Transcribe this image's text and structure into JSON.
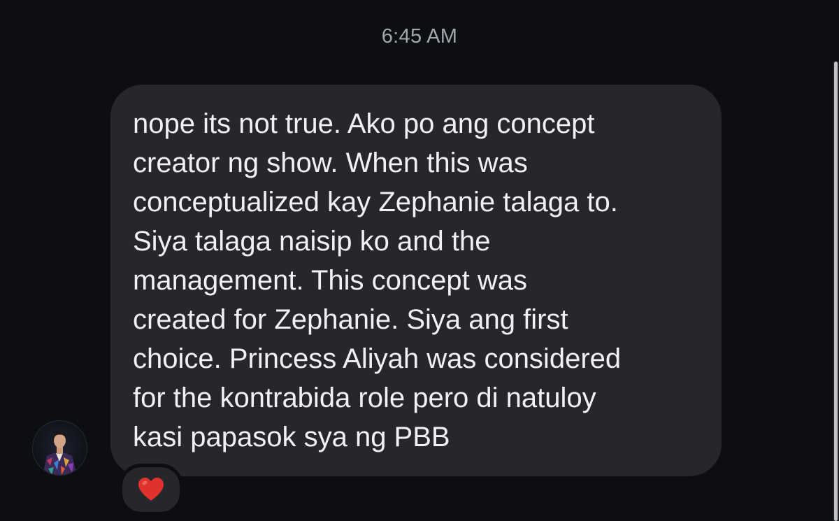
{
  "chat": {
    "timestamp": "6:45 AM",
    "message": {
      "text": "nope its not true. Ako po ang concept\ncreator ng show. When this was\nconceptualized kay Zephanie talaga to.\nSiya talaga naisip ko and the\nmanagement. This concept was\ncreated for Zephanie. Siya ang first\nchoice. Princess Aliyah was considered\nfor the kontrabida role pero di natuloy\nkasi papasok sya ng PBB",
      "reaction": "heart-icon"
    },
    "sender": {
      "avatar": "avatar"
    }
  },
  "colors": {
    "background": "#0c0e12",
    "bubble": "#25272c",
    "text": "#f1f1f3",
    "timestamp": "#a3a6ad",
    "heart": "#e0312c"
  }
}
